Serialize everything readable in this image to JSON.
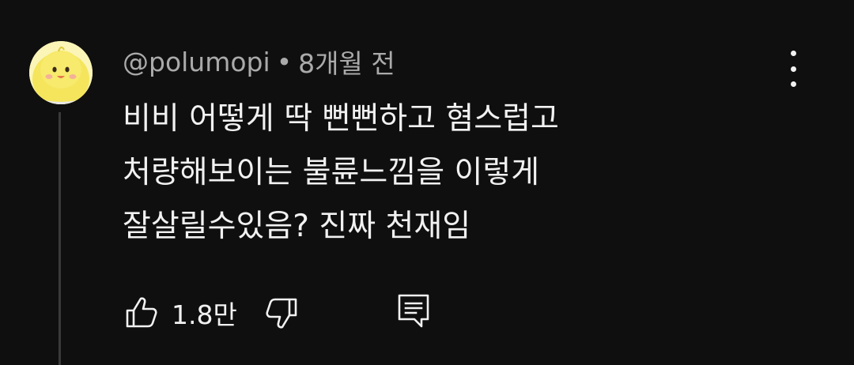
{
  "comment": {
    "author": "@polumopi",
    "separator": "•",
    "timestamp": "8개월 전",
    "text_lines": [
      "비비 어떻게 딱 뻔뻔하고 혐스럽고",
      "처량해보이는 불륜느낌을 이렇게",
      "잘살릴수있음? 진짜 천재임"
    ],
    "like_count": "1.8만",
    "icons": {
      "more": "more-vert-icon",
      "like": "thumbs-up-icon",
      "dislike": "thumbs-down-icon",
      "reply": "comment-icon",
      "avatar": "chick-avatar"
    }
  },
  "colors": {
    "background": "#0f0f0f",
    "primary_text": "#f1f1f1",
    "secondary_text": "#aaaaaa",
    "thread_line": "#3a3a3a"
  }
}
